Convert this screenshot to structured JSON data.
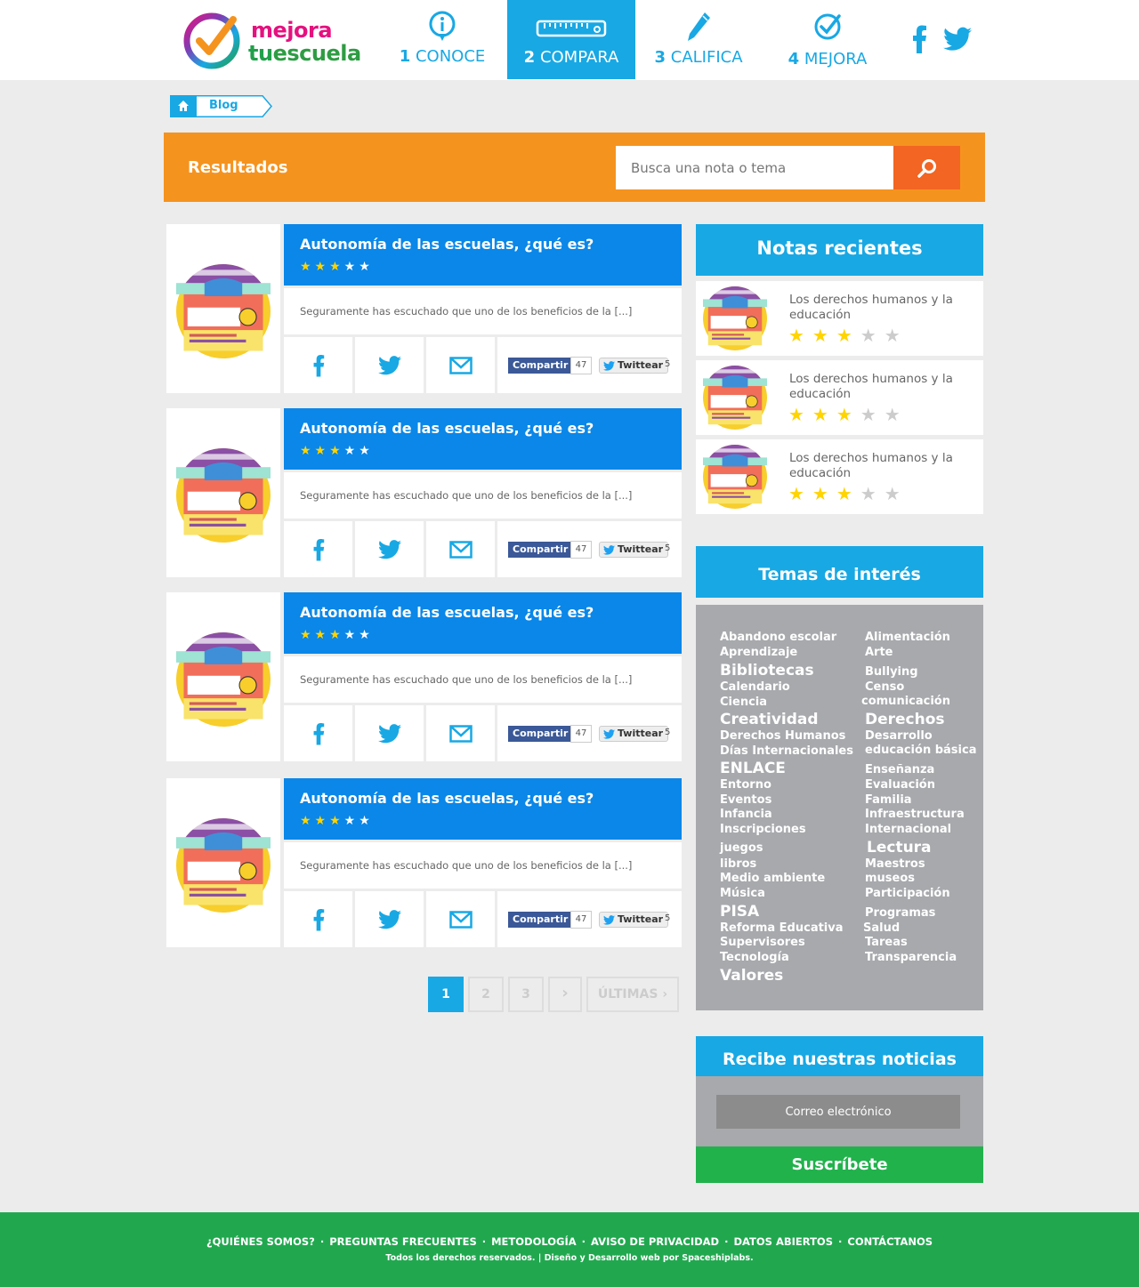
{
  "header": {
    "logo_line1": "mejora",
    "logo_line2_a": "tu",
    "logo_line2_b": "escuela",
    "nav": [
      {
        "num": "1",
        "label": "CONOCE",
        "icon": "info-icon"
      },
      {
        "num": "2",
        "label": "COMPARA",
        "icon": "ruler-icon",
        "active": true
      },
      {
        "num": "3",
        "label": "CALIFICA",
        "icon": "pen-icon"
      },
      {
        "num": "4",
        "label": "MEJORA",
        "icon": "check-circle-icon"
      }
    ],
    "social": [
      "facebook-icon",
      "twitter-icon"
    ]
  },
  "breadcrumb": {
    "label": "Blog"
  },
  "search": {
    "title": "Resultados",
    "placeholder": "Busca una nota o tema"
  },
  "articles": [
    {
      "title": "Autonomía de las escuelas, ¿qué es?",
      "excerpt": "Seguramente has escuchado que uno de los beneficios de la [...]",
      "fb_label": "Compartir",
      "fb_count": "47",
      "tw_label": "Twittear",
      "tw_count": "5",
      "stars": "★★★",
      "stars_rest": "★★"
    },
    {
      "title": "Autonomía de las escuelas, ¿qué es?",
      "excerpt": "Seguramente has escuchado que uno de los beneficios de la [...]",
      "fb_label": "Compartir",
      "fb_count": "47",
      "tw_label": "Twittear",
      "tw_count": "5",
      "stars": "★★★",
      "stars_rest": "★★"
    },
    {
      "title": "Autonomía de las escuelas, ¿qué es?",
      "excerpt": "Seguramente has escuchado que uno de los beneficios de la [...]",
      "fb_label": "Compartir",
      "fb_count": "47",
      "tw_label": "Twittear",
      "tw_count": "5",
      "stars": "★★★",
      "stars_rest": "★★"
    },
    {
      "title": "Autonomía de las escuelas, ¿qué es?",
      "excerpt": "Seguramente has escuchado que uno de los beneficios de la [...]",
      "fb_label": "Compartir",
      "fb_count": "47",
      "tw_label": "Twittear",
      "tw_count": "5",
      "stars": "★★★",
      "stars_rest": "★★"
    }
  ],
  "pagination": {
    "pages": [
      "1",
      "2",
      "3"
    ],
    "next": "›",
    "last": "ÚLTIMAS ›",
    "current": "1"
  },
  "sidebar": {
    "recent_title": "Notas recientes",
    "recent": [
      {
        "title": "Los derechos humanos y la educación",
        "stars": "★★★",
        "stars_rest": "★★"
      },
      {
        "title": "Los derechos humanos y la educación",
        "stars": "★★★",
        "stars_rest": "★★"
      },
      {
        "title": "Los derechos humanos y la educación",
        "stars": "★★★",
        "stars_rest": "★★"
      }
    ],
    "topics_title": "Temas de interés",
    "topics_left": [
      "Abandono escolar",
      "Aprendizaje",
      "Bibliotecas",
      "Calendario",
      "Ciencia",
      "Creatividad",
      "Derechos Humanos",
      "Días Internacionales",
      "ENLACE",
      "Entorno",
      "Eventos",
      "Infancia",
      "Inscripciones",
      "juegos",
      "libros",
      "Medio ambiente",
      "Música",
      "PISA",
      "Reforma Educativa",
      "Supervisores",
      "Tecnología",
      "Valores"
    ],
    "topics_right": [
      "Alimentación",
      "Arte",
      "Bullying",
      "Censo",
      "comunicación",
      "Derechos",
      "Desarrollo",
      "educación básica",
      "Enseñanza",
      "Evaluación",
      "Familia",
      "Infraestructura",
      "Internacional",
      "Lectura",
      "Maestros",
      "museos",
      "Participación",
      "Programas",
      "Salud",
      "Tareas",
      "Transparencia"
    ],
    "newsletter_title": "Recibe nuestras noticias",
    "email_placeholder": "Correo electrónico",
    "subscribe_label": "Suscríbete"
  },
  "footer": {
    "links": [
      "¿QUIÉNES SOMOS?",
      "PREGUNTAS FRECUENTES",
      "METODOLOGÍA",
      "AVISO DE PRIVACIDAD",
      "DATOS ABIERTOS",
      "CONTÁCTANOS"
    ],
    "separator": "·",
    "copyright": "Todos los derechos reservados. | Diseño y Desarrollo web por Spaceshiplabs."
  },
  "colors": {
    "blue": "#18a8e4",
    "dark_blue": "#0a87e8",
    "orange": "#f5931f",
    "green": "#21a84f",
    "grey": "#a7a9ac",
    "star": "#ffd400"
  }
}
